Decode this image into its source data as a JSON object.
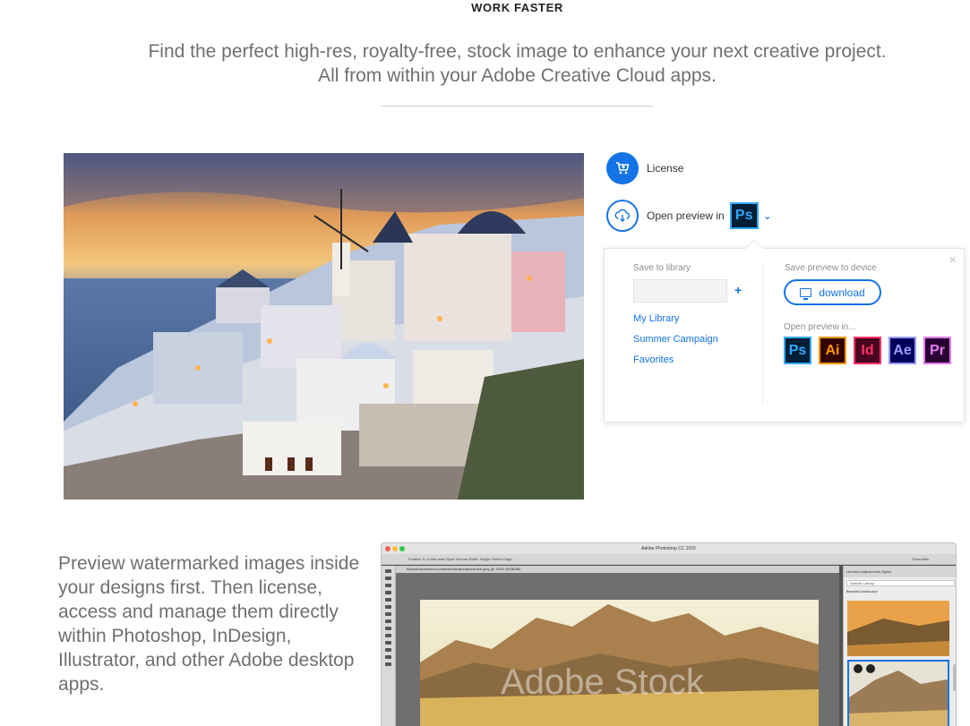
{
  "header": {
    "eyebrow": "WORK FASTER",
    "lead_line1": "Find the perfect high-res, royalty-free, stock image to enhance your next creative project.",
    "lead_line2": "All from within your Adobe Creative Cloud apps."
  },
  "actions": {
    "license_label": "License",
    "preview_label": "Open preview in",
    "preview_app": "Ps"
  },
  "popup": {
    "close_glyph": "×",
    "save_library_label": "Save to library",
    "add_glyph": "+",
    "libraries": [
      "My Library",
      "Summer Campaign",
      "Favorites"
    ],
    "save_device_label": "Save preview to device",
    "download_label": "download",
    "open_in_label": "Open preview in...",
    "apps": [
      {
        "abbr": "Ps",
        "bg": "#001e36",
        "fg": "#31a8ff"
      },
      {
        "abbr": "Ai",
        "bg": "#330000",
        "fg": "#ff9a00"
      },
      {
        "abbr": "Id",
        "bg": "#49021f",
        "fg": "#ff3366"
      },
      {
        "abbr": "Ae",
        "bg": "#00005b",
        "fg": "#9999ff"
      },
      {
        "abbr": "Pr",
        "bg": "#2a0034",
        "fg": "#e77bf2"
      }
    ]
  },
  "body_copy": "Preview watermarked images inside your designs first. Then license, access and manage them directly within Photoshop, InDesign, Illustrator, and other Adobe desktop apps.",
  "photoshop": {
    "title": "Adobe Photoshop CC 2015",
    "options": "Feather: 0 px    Anti-alias   Style: Normal   Width:    Height:    Refine Edge...",
    "workspace": "Essentials",
    "doc_tab": "Beautifulsummermountainlandscapeatsunshine.jpeg @ 100% (RGB/8#)",
    "panel_tabs": "Libraries   Adjustments   Styles",
    "panel_select": "Sample Library",
    "panel_section": "Beautiful landscape",
    "watermark": "Adobe Stock"
  },
  "colors": {
    "accent": "#1473e6",
    "text_gray": "#707070"
  }
}
